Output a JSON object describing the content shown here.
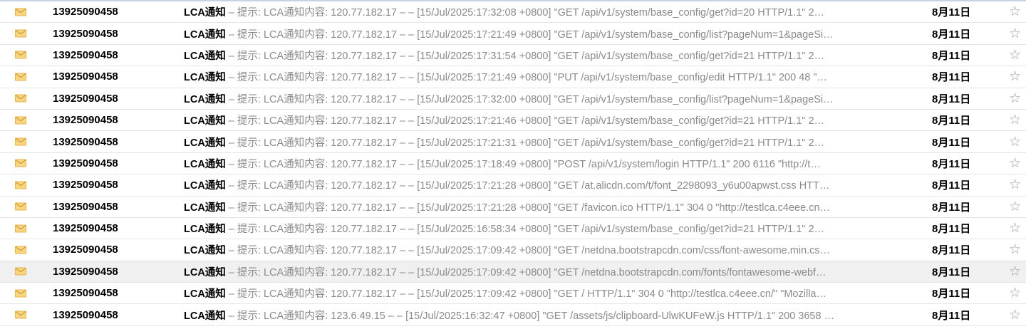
{
  "icons": {
    "row_icon": "envelope-icon",
    "flag_icon": "star-icon",
    "envelope_color": "#e8b34a"
  },
  "emails": [
    {
      "sender": "13925090458",
      "subject": "LCA通知",
      "preview": " – 提示: LCA通知内容: 120.77.182.17 – – [15/Jul/2025:17:32:08 +0800] \"GET /api/v1/system/base_config/get?id=20 HTTP/1.1\" 2…",
      "date": "8月11日",
      "highlighted": false
    },
    {
      "sender": "13925090458",
      "subject": "LCA通知",
      "preview": " – 提示: LCA通知内容: 120.77.182.17 – – [15/Jul/2025:17:21:49 +0800] \"GET /api/v1/system/base_config/list?pageNum=1&pageSi…",
      "date": "8月11日",
      "highlighted": false
    },
    {
      "sender": "13925090458",
      "subject": "LCA通知",
      "preview": " – 提示: LCA通知内容: 120.77.182.17 – – [15/Jul/2025:17:31:54 +0800] \"GET /api/v1/system/base_config/get?id=21 HTTP/1.1\" 2…",
      "date": "8月11日",
      "highlighted": false
    },
    {
      "sender": "13925090458",
      "subject": "LCA通知",
      "preview": " – 提示: LCA通知内容: 120.77.182.17 – – [15/Jul/2025:17:21:49 +0800] \"PUT /api/v1/system/base_config/edit HTTP/1.1\" 200 48 \"…",
      "date": "8月11日",
      "highlighted": false
    },
    {
      "sender": "13925090458",
      "subject": "LCA通知",
      "preview": " – 提示: LCA通知内容: 120.77.182.17 – – [15/Jul/2025:17:32:00 +0800] \"GET /api/v1/system/base_config/list?pageNum=1&pageSi…",
      "date": "8月11日",
      "highlighted": false
    },
    {
      "sender": "13925090458",
      "subject": "LCA通知",
      "preview": " – 提示: LCA通知内容: 120.77.182.17 – – [15/Jul/2025:17:21:46 +0800] \"GET /api/v1/system/base_config/get?id=21 HTTP/1.1\" 2…",
      "date": "8月11日",
      "highlighted": false
    },
    {
      "sender": "13925090458",
      "subject": "LCA通知",
      "preview": " – 提示: LCA通知内容: 120.77.182.17 – – [15/Jul/2025:17:21:31 +0800] \"GET /api/v1/system/base_config/get?id=21 HTTP/1.1\" 2…",
      "date": "8月11日",
      "highlighted": false
    },
    {
      "sender": "13925090458",
      "subject": "LCA通知",
      "preview": " – 提示: LCA通知内容: 120.77.182.17 – – [15/Jul/2025:17:18:49 +0800] \"POST /api/v1/system/login HTTP/1.1\" 200 6116 \"http://t…",
      "date": "8月11日",
      "highlighted": false
    },
    {
      "sender": "13925090458",
      "subject": "LCA通知",
      "preview": " – 提示: LCA通知内容: 120.77.182.17 – – [15/Jul/2025:17:21:28 +0800] \"GET /at.alicdn.com/t/font_2298093_y6u00apwst.css HTT…",
      "date": "8月11日",
      "highlighted": false
    },
    {
      "sender": "13925090458",
      "subject": "LCA通知",
      "preview": " – 提示: LCA通知内容: 120.77.182.17 – – [15/Jul/2025:17:21:28 +0800] \"GET /favicon.ico HTTP/1.1\" 304 0 \"http://testlca.c4eee.cn…",
      "date": "8月11日",
      "highlighted": false
    },
    {
      "sender": "13925090458",
      "subject": "LCA通知",
      "preview": " – 提示: LCA通知内容: 120.77.182.17 – – [15/Jul/2025:16:58:34 +0800] \"GET /api/v1/system/base_config/get?id=21 HTTP/1.1\" 2…",
      "date": "8月11日",
      "highlighted": false
    },
    {
      "sender": "13925090458",
      "subject": "LCA通知",
      "preview": " – 提示: LCA通知内容: 120.77.182.17 – – [15/Jul/2025:17:09:42 +0800] \"GET /netdna.bootstrapcdn.com/css/font-awesome.min.cs…",
      "date": "8月11日",
      "highlighted": false
    },
    {
      "sender": "13925090458",
      "subject": "LCA通知",
      "preview": " – 提示: LCA通知内容: 120.77.182.17 – – [15/Jul/2025:17:09:42 +0800] \"GET /netdna.bootstrapcdn.com/fonts/fontawesome-webf…",
      "date": "8月11日",
      "highlighted": true
    },
    {
      "sender": "13925090458",
      "subject": "LCA通知",
      "preview": " – 提示: LCA通知内容: 120.77.182.17 – – [15/Jul/2025:17:09:42 +0800] \"GET / HTTP/1.1\" 304 0 \"http://testlca.c4eee.cn/\" \"Mozilla…",
      "date": "8月11日",
      "highlighted": false
    },
    {
      "sender": "13925090458",
      "subject": "LCA通知",
      "preview": " – 提示: LCA通知内容: 123.6.49.15 – – [15/Jul/2025:16:32:47 +0800] \"GET /assets/js/clipboard-UlwKUFeW.js HTTP/1.1\" 200 3658 …",
      "date": "8月11日",
      "highlighted": false
    }
  ]
}
